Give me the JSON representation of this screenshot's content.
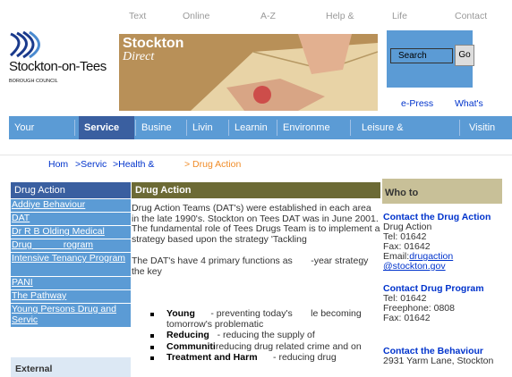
{
  "top_links": [
    "Text",
    "Online",
    "A-Z",
    "Help &",
    "Life",
    "Contact"
  ],
  "logo": {
    "name": "Stockton-on-Tees",
    "sub": "BOROUGH COUNCIL"
  },
  "banner": {
    "line1": "Stockton",
    "line2": "Direct"
  },
  "search": {
    "placeholder": "Search",
    "go_label": "Go"
  },
  "sublinks": [
    "e-Press",
    "What's"
  ],
  "nav": [
    {
      "label": "Your"
    },
    {
      "label": "Service"
    },
    {
      "label": "Busine"
    },
    {
      "label": "Livin"
    },
    {
      "label": "Learnin"
    },
    {
      "label": "Environme"
    },
    {
      "label": "Leisure &"
    },
    {
      "label": "Visitin"
    }
  ],
  "breadcrumb": [
    "Hom",
    ">Servic",
    ">Health &",
    "> Drug Action"
  ],
  "sidebar": {
    "title": "Drug Action",
    "items": [
      "Addiye Behaviour",
      "DAT",
      "Dr R B Olding Medical",
      "Drug            rogram",
      "Intensive Tenancy Program",
      "PANI",
      "The Pathway",
      "Young Persons Drug and Servic"
    ],
    "external": "External"
  },
  "main": {
    "title": "Drug Action",
    "para1": "Drug Action Teams (DAT's) were established in each area in the late 1990's. Stockton on Tees DAT was in June 2001. The fundamental role of Tees Drugs Team is to implement a strategy based upon the strategy 'Tackling",
    "para2": "The DAT's have 4 primary functions as       -year strategy the key",
    "bullets": [
      {
        "term": "Young",
        "text": "      - preventing today's       le becoming tomorrow's problematic"
      },
      {
        "term": "Reducing",
        "text": "   - reducing the supply of"
      },
      {
        "term": "Communiti",
        "text": "reducing drug related crime and on"
      },
      {
        "term": "Treatment and Harm",
        "text": "      - reducing drug"
      }
    ]
  },
  "right": {
    "title": "Who to",
    "c1": {
      "title": "Contact the Drug Action",
      "l1": "Drug Action",
      "l2": "Tel: 01642",
      "l3": "Fax: 01642",
      "l4": "Email:",
      "email_a": "drugaction",
      "email_b": "@stockton.gov"
    },
    "c2": {
      "title": "Contact Drug Program",
      "l1": "Tel: 01642",
      "l2": "Freephone: 0808",
      "l3": "Fax: 01642"
    },
    "c3": {
      "title": "Contact the Behaviour",
      "l1": "2931 Yarm Lane, Stockton"
    }
  },
  "colors": {
    "nav_blue": "#5b9bd5",
    "nav_active": "#3a5fa0",
    "main_head": "#6c6a35",
    "right_head": "#c8c098",
    "link": "#0033cc",
    "crumb_current": "#f08c28"
  }
}
